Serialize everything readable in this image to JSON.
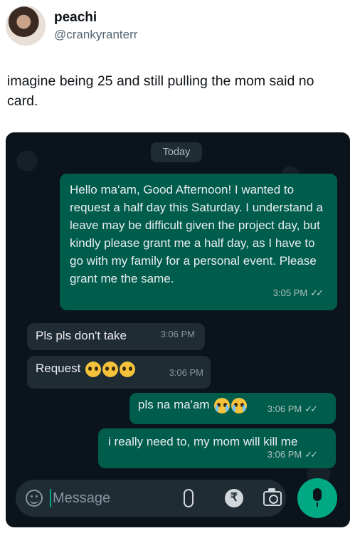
{
  "tweet": {
    "display_name": "peachi",
    "handle": "@crankyranterr",
    "text": "imagine being 25 and still pulling the mom said no card."
  },
  "chat": {
    "date_chip": "Today",
    "messages": [
      {
        "direction": "outgoing",
        "text": "Hello ma'am, Good Afternoon! I wanted to request a half day this Saturday. I understand a leave may be difficult given the project day, but kindly please grant me a half day, as I have to go with my family for a personal event. Please grant me the same.",
        "time": "3:05 PM",
        "status": "read"
      },
      {
        "direction": "incoming",
        "text": "Pls pls don't take",
        "time": "3:06 PM"
      },
      {
        "direction": "incoming",
        "text": "Request",
        "emojis": [
          "pleading-face",
          "pleading-face",
          "pleading-face"
        ],
        "time": "3:06 PM"
      },
      {
        "direction": "outgoing",
        "text": "pls na ma'am",
        "emojis": [
          "crying-face",
          "crying-face"
        ],
        "time": "3:06 PM",
        "status": "read"
      },
      {
        "direction": "outgoing",
        "text": "i really need to, my mom will kill me",
        "time": "3:06 PM",
        "status": "read"
      }
    ],
    "ticks_glyph": "✓✓",
    "composer": {
      "placeholder": "Message",
      "icons": [
        "emoji-icon",
        "attach-icon",
        "rupee-icon",
        "camera-icon",
        "mic-icon"
      ],
      "rupee_glyph": "₹"
    }
  },
  "colors": {
    "chat_bg": "#0b141a",
    "outgoing_bubble": "#005c4b",
    "incoming_bubble": "#202c33",
    "accent": "#00a884"
  }
}
